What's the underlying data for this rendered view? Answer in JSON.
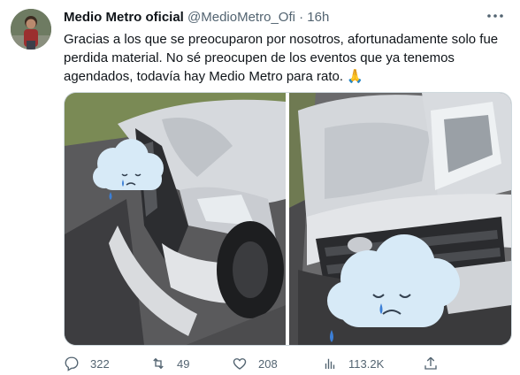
{
  "tweet": {
    "author_name": "Medio Metro oficial",
    "handle": "@MedioMetro_Ofi",
    "separator": "·",
    "time": "16h",
    "lines": [
      "Gracias a los que se preocuparon por nosotros, afortunadamente solo fue",
      "perdida material. No sé preocupen de los eventos que ya tenemos",
      "agendados, todavía hay Medio Metro para rato. 🙏"
    ]
  },
  "icons": {
    "more": "more-icon",
    "reply": "reply-icon",
    "retweet": "retweet-icon",
    "like": "heart-icon",
    "views": "views-icon",
    "share": "share-icon"
  },
  "stats": {
    "replies": "322",
    "retweets": "49",
    "likes": "208",
    "views": "113.2K"
  },
  "colors": {
    "text": "#0f1419",
    "secondary": "#536471",
    "border": "#cfd9de"
  }
}
